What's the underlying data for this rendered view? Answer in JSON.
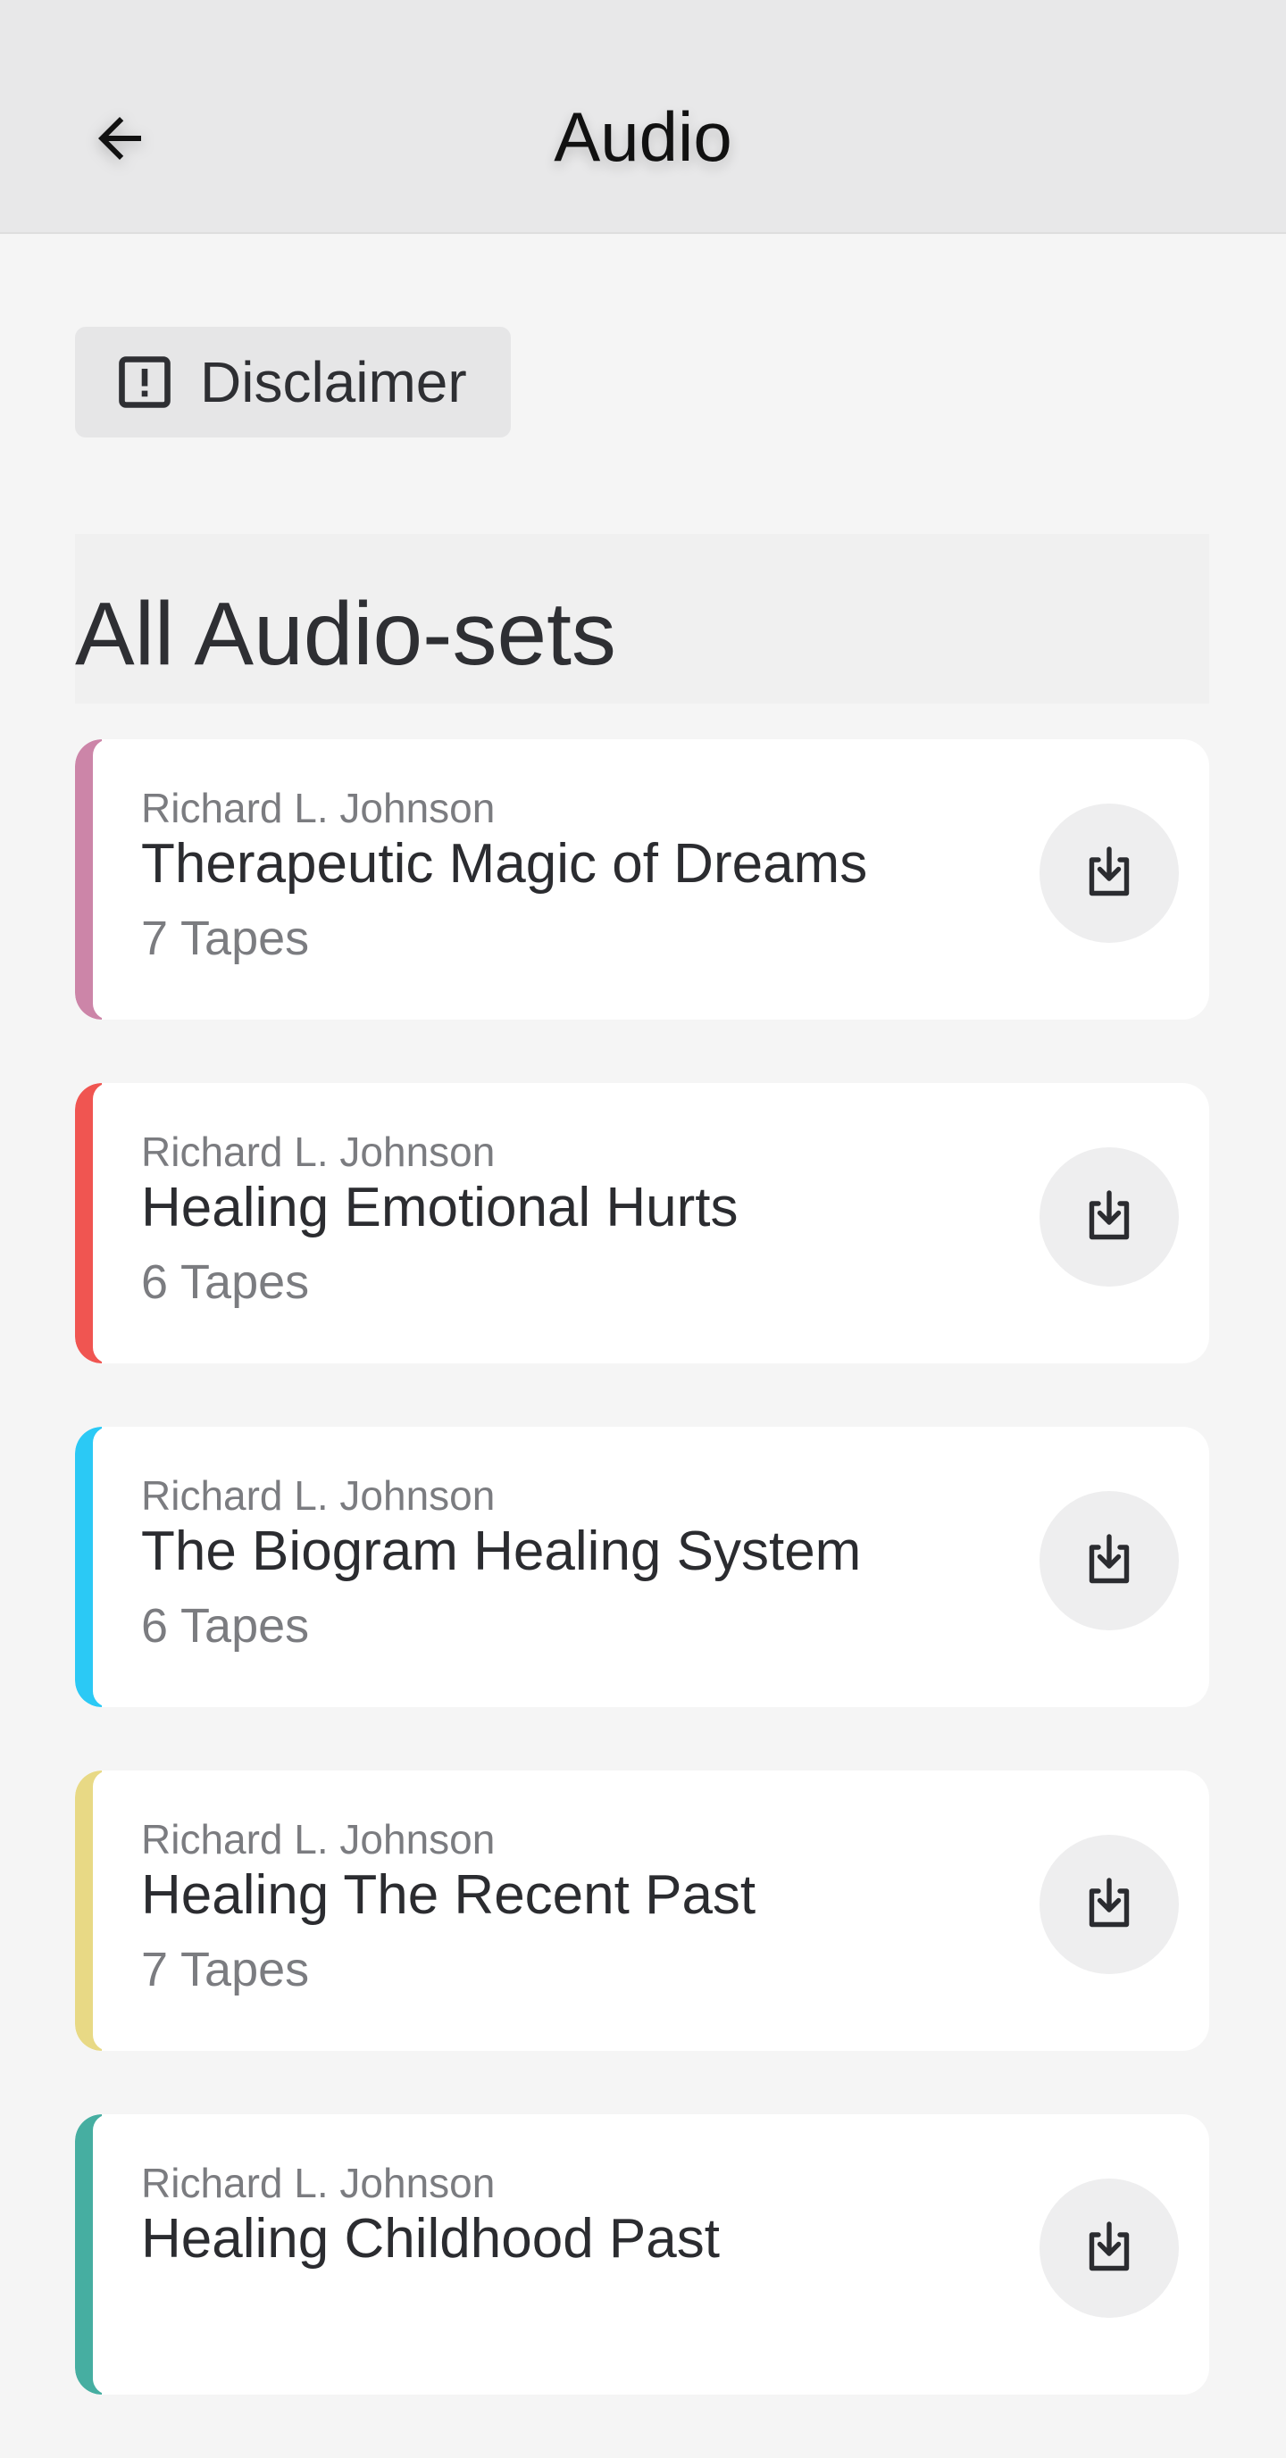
{
  "header": {
    "title": "Audio",
    "back_icon": "arrow-left-icon"
  },
  "disclaimer": {
    "label": "Disclaimer",
    "icon": "exclamation-box-icon"
  },
  "section": {
    "title": "All Audio-sets"
  },
  "audio_sets": [
    {
      "author": "Richard L. Johnson",
      "title": "Therapeutic Magic of Dreams",
      "count": "7 Tapes",
      "accent": "#cc85a8"
    },
    {
      "author": "Richard L. Johnson",
      "title": "Healing Emotional Hurts",
      "count": "6 Tapes",
      "accent": "#f05551"
    },
    {
      "author": "Richard L. Johnson",
      "title": "The Biogram Healing System",
      "count": "6 Tapes",
      "accent": "#2bc9f5"
    },
    {
      "author": "Richard L. Johnson",
      "title": "Healing The Recent Past",
      "count": "7 Tapes",
      "accent": "#e8d985"
    },
    {
      "author": "Richard L. Johnson",
      "title": "Healing Childhood Past",
      "count": "",
      "accent": "#46aea1"
    }
  ]
}
